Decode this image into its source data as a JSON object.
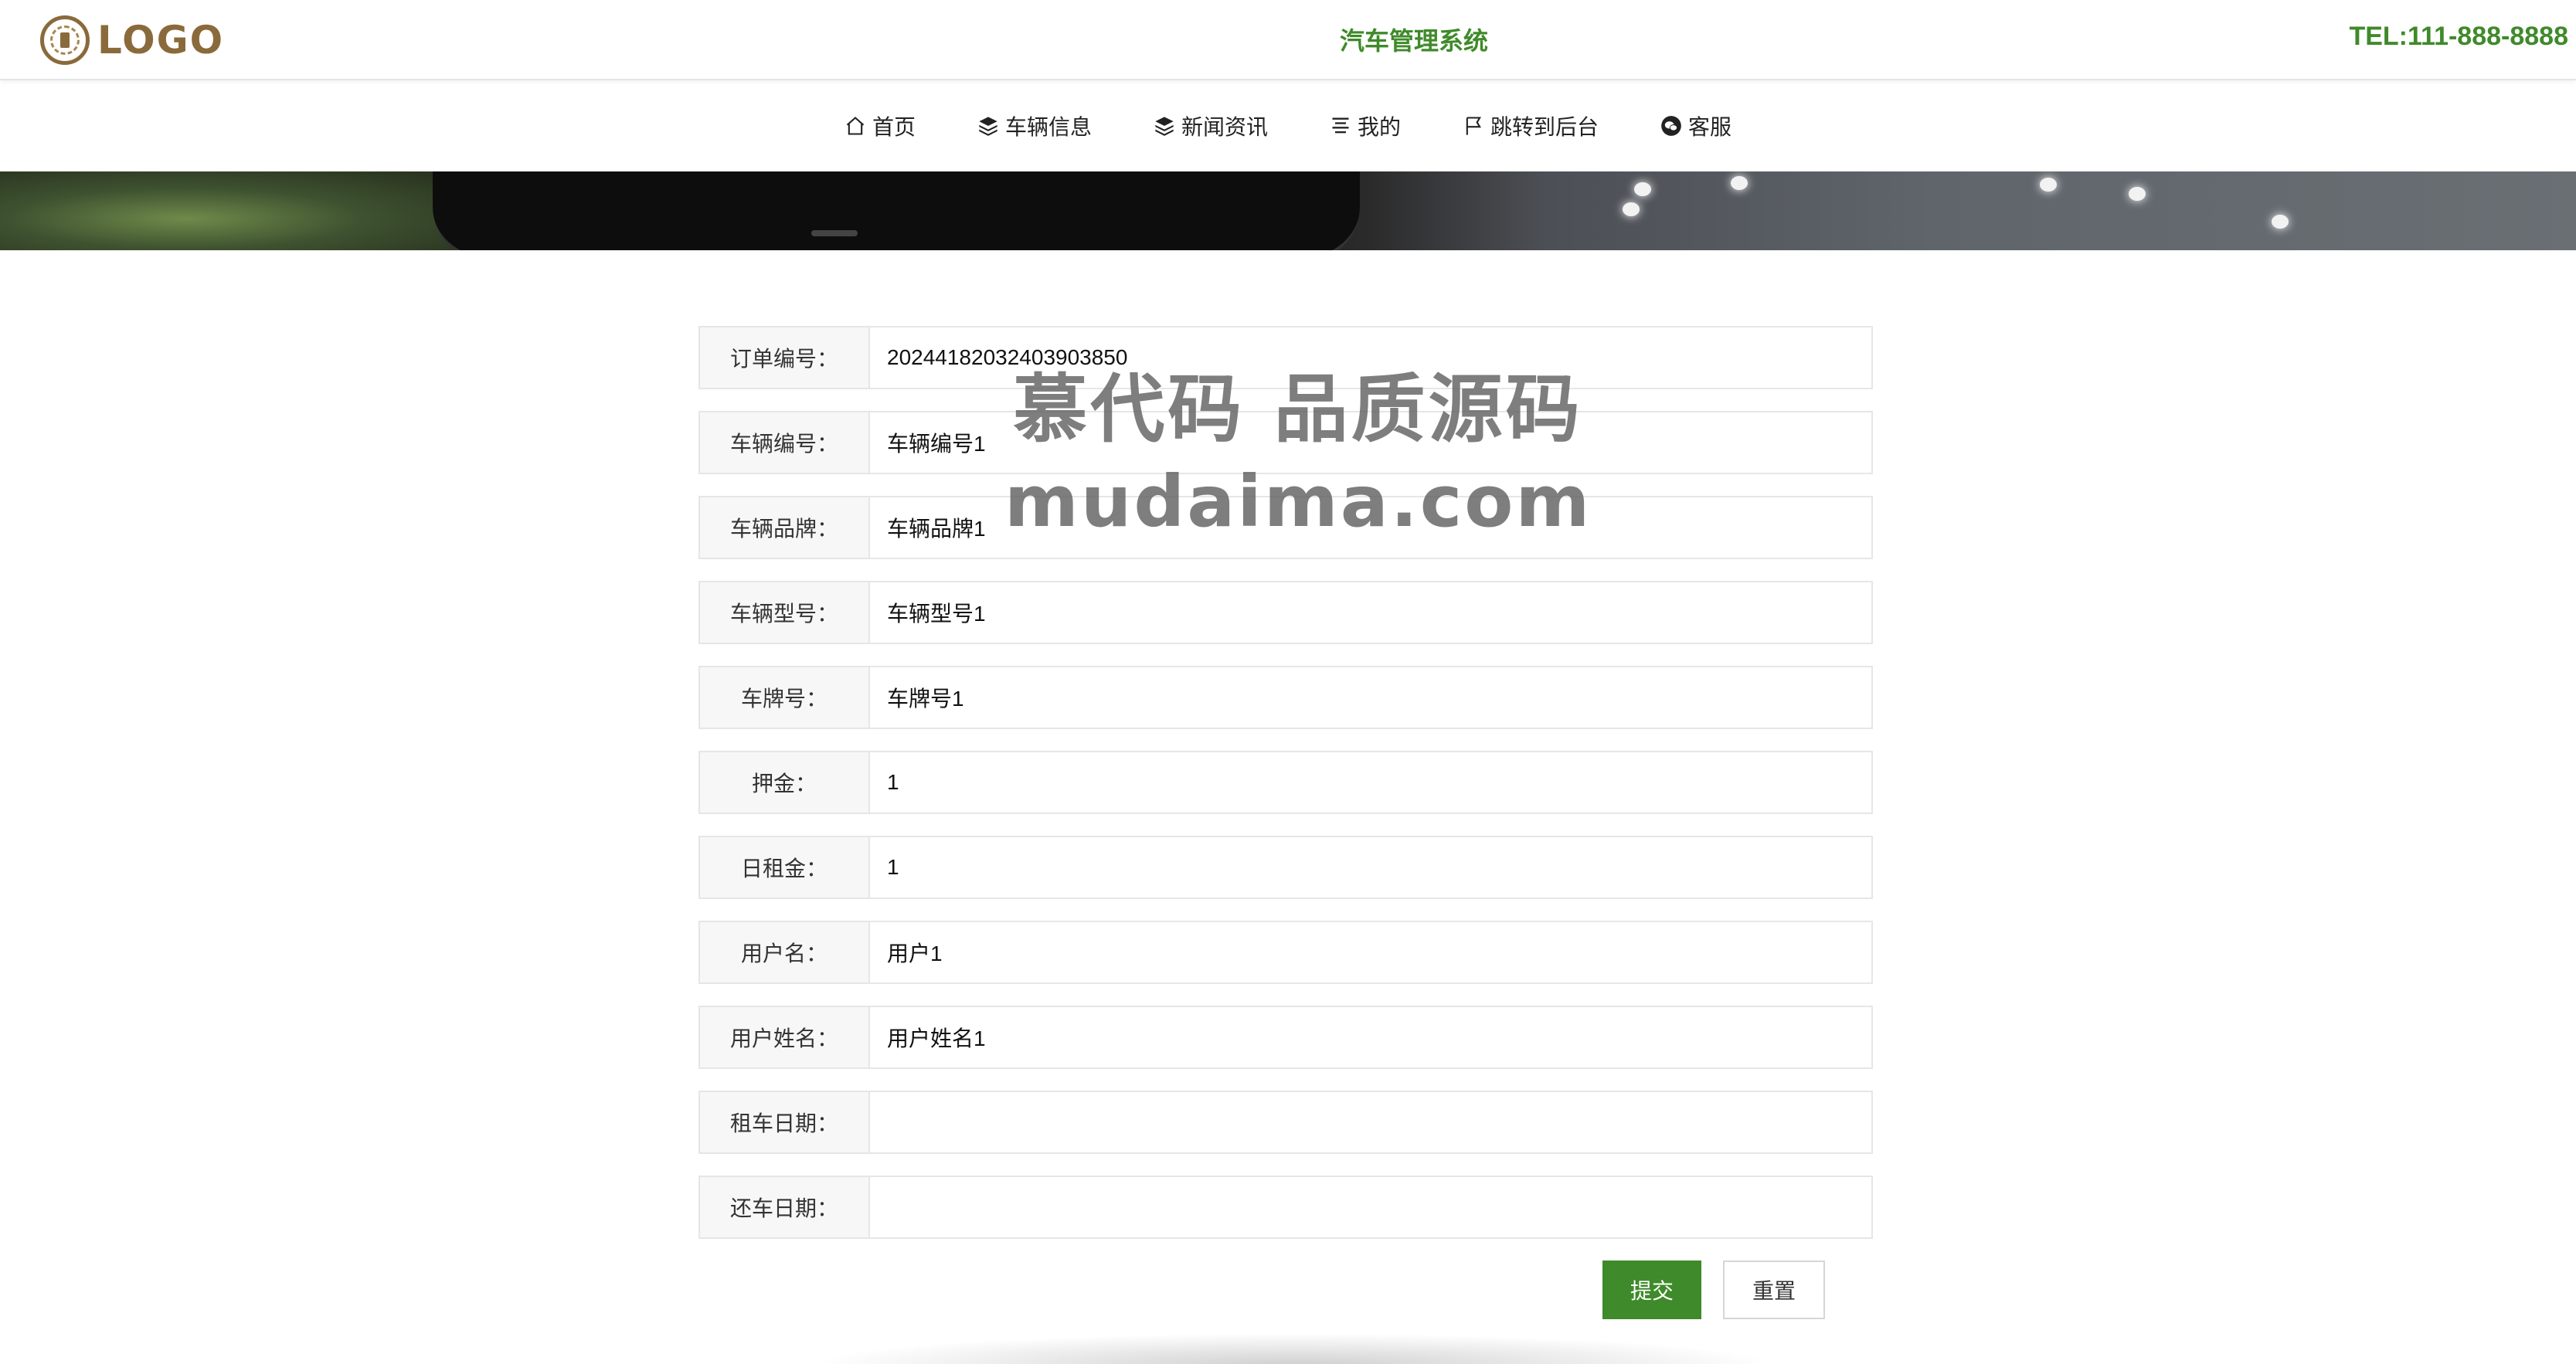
{
  "header": {
    "logo_text": "LOGO",
    "title": "汽车管理系统",
    "tel": "TEL:111-888-8888"
  },
  "nav": {
    "items": [
      {
        "label": "首页",
        "icon": "home-icon"
      },
      {
        "label": "车辆信息",
        "icon": "layers-icon"
      },
      {
        "label": "新闻资讯",
        "icon": "layers-icon"
      },
      {
        "label": "我的",
        "icon": "list-icon"
      },
      {
        "label": "跳转到后台",
        "icon": "flag-icon"
      },
      {
        "label": "客服",
        "icon": "wechat-icon"
      }
    ]
  },
  "form": {
    "fields": [
      {
        "label": "订单编号：",
        "value": "20244182032403903850"
      },
      {
        "label": "车辆编号：",
        "value": "车辆编号1"
      },
      {
        "label": "车辆品牌：",
        "value": "车辆品牌1"
      },
      {
        "label": "车辆型号：",
        "value": "车辆型号1"
      },
      {
        "label": "车牌号：",
        "value": "车牌号1"
      },
      {
        "label": "押金：",
        "value": "1"
      },
      {
        "label": "日租金：",
        "value": "1"
      },
      {
        "label": "用户名：",
        "value": "用户1"
      },
      {
        "label": "用户姓名：",
        "value": "用户姓名1"
      },
      {
        "label": "租车日期：",
        "value": ""
      },
      {
        "label": "还车日期：",
        "value": ""
      }
    ],
    "submit_label": "提交",
    "reset_label": "重置"
  },
  "watermark": {
    "line1": "慕代码 品质源码",
    "line2": "mudaima.com"
  },
  "colors": {
    "accent": "#3f8a2a",
    "logo": "#8a6a3b"
  }
}
